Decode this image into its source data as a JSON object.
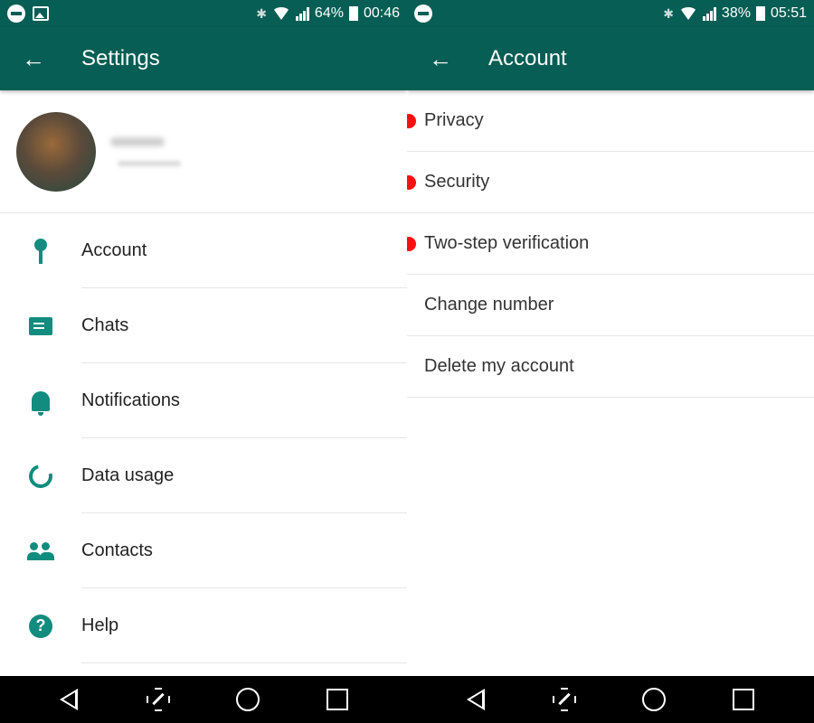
{
  "left": {
    "status": {
      "battery": "64%",
      "time": "00:46"
    },
    "appbar": {
      "back": "←",
      "title": "Settings"
    },
    "items": [
      {
        "label": "Account",
        "icon": "key-icon"
      },
      {
        "label": "Chats",
        "icon": "chat-icon"
      },
      {
        "label": "Notifications",
        "icon": "bell-icon"
      },
      {
        "label": "Data usage",
        "icon": "data-usage-icon"
      },
      {
        "label": "Contacts",
        "icon": "contacts-icon"
      },
      {
        "label": "Help",
        "icon": "help-icon",
        "glyph": "?"
      }
    ]
  },
  "right": {
    "status": {
      "battery": "38%",
      "time": "05:51"
    },
    "appbar": {
      "back": "←",
      "title": "Account"
    },
    "items": [
      {
        "label": "Privacy",
        "marked": true
      },
      {
        "label": "Security",
        "marked": true
      },
      {
        "label": "Two-step verification",
        "marked": true
      },
      {
        "label": "Change number",
        "marked": false
      },
      {
        "label": "Delete my account",
        "marked": false
      }
    ]
  },
  "colors": {
    "primary": "#075e54",
    "icon": "#128c7e",
    "marker": "#ff1010"
  },
  "icons": {
    "bluetooth": "✱"
  }
}
